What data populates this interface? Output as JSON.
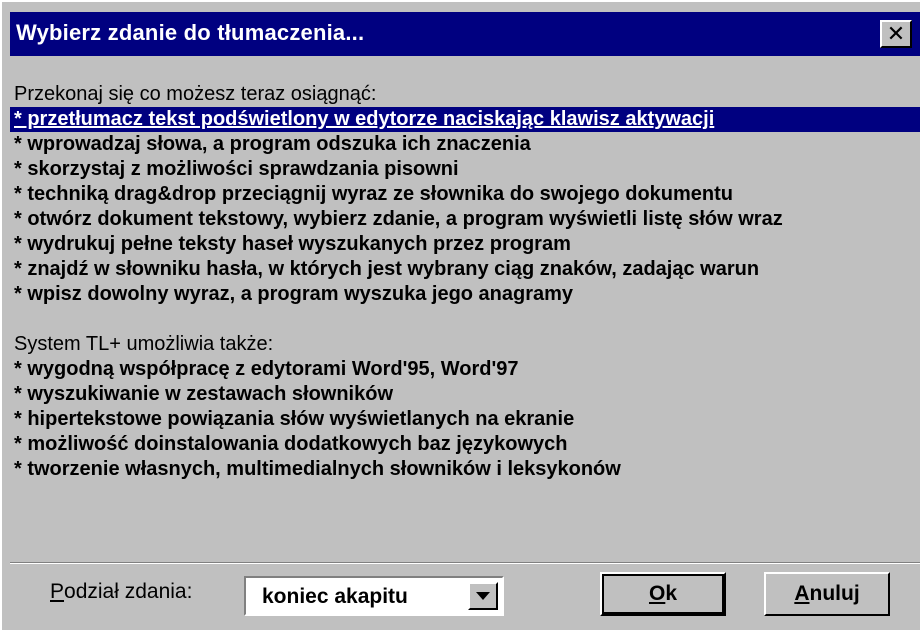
{
  "window": {
    "title": "Wybierz zdanie do tłumaczenia...",
    "close_symbol": "✕"
  },
  "content": {
    "heading1": "Przekonaj się co możesz teraz osiągnąć:",
    "items1": [
      "* przetłumacz tekst podświetlony w edytorze naciskając klawisz aktywacji",
      "* wprowadzaj słowa, a program odszuka ich znaczenia",
      "* skorzystaj z możliwości sprawdzania pisowni",
      "* techniką drag&drop przeciągnij wyraz ze słownika do swojego dokumentu",
      "* otwórz dokument tekstowy, wybierz zdanie, a program wyświetli listę słów wraz",
      "* wydrukuj pełne teksty haseł wyszukanych przez program",
      "* znajdź w słowniku hasła, w których jest wybrany ciąg znaków, zadając warun",
      "* wpisz dowolny wyraz, a program wyszuka jego anagramy"
    ],
    "heading2": "System TL+ umożliwia także:",
    "items2": [
      "* wygodną współpracę z edytorami Word'95, Word'97",
      "* wyszukiwanie w zestawach słowników",
      "* hipertekstowe powiązania słów wyświetlanych na ekranie",
      "* możliwość doinstalowania dodatkowych baz językowych",
      "* tworzenie własnych, multimedialnych słowników i leksykonów"
    ],
    "selected_index": 0
  },
  "footer": {
    "split_label_first": "P",
    "split_label_rest": "odział zdania:",
    "split_value": "koniec akapitu",
    "ok_first": "O",
    "ok_rest": "k",
    "cancel_first": "A",
    "cancel_rest": "nuluj"
  },
  "colors": {
    "titlebar": "#000080",
    "face": "#c0c0c0",
    "highlight": "#000080"
  }
}
